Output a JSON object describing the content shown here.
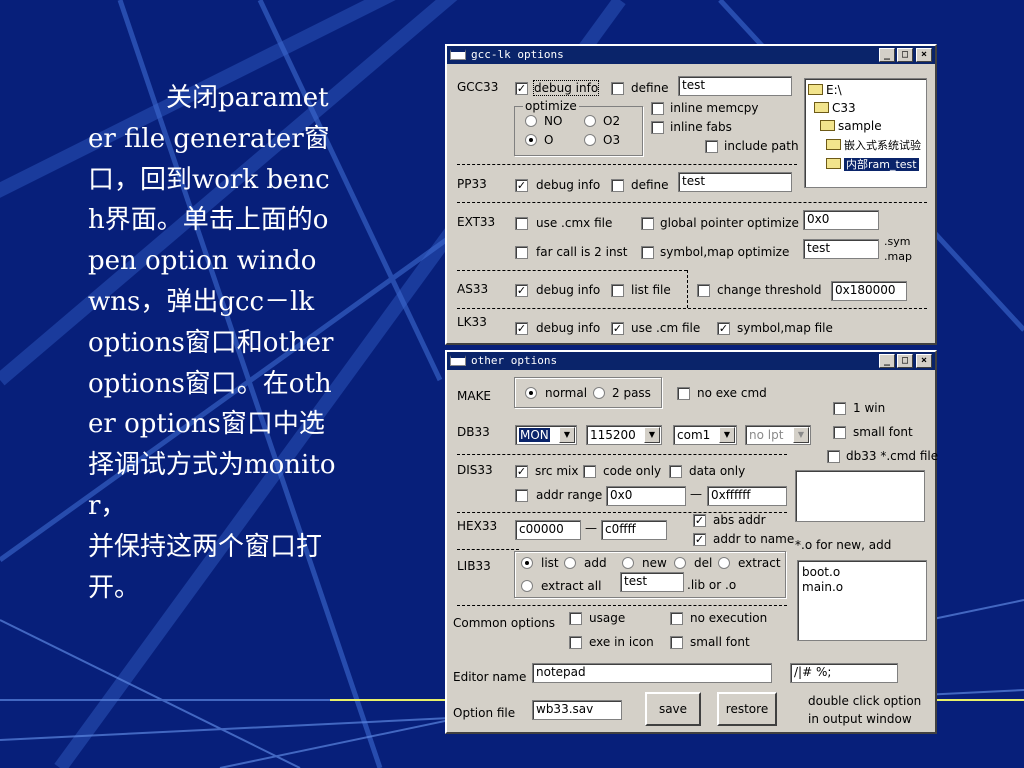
{
  "slide_text": "关闭parameter file generater窗口，回到work bench界面。单击上面的open option windowns，弹出gcc－lk options窗口和other options窗口。在other options窗口中选择调试方式为monitor，\n并保持这两个窗口打开。",
  "colors": {
    "slide_bg": "#071f7a",
    "titlebar": "#0a246a",
    "window_face": "#d4d0c8"
  },
  "gcc_window": {
    "title": "gcc-lk options",
    "controls": [
      "_",
      "□",
      "×"
    ],
    "gcc33": {
      "label": "GCC33",
      "debug_info": {
        "label": "debug info",
        "checked": true
      },
      "define": {
        "label": "define",
        "checked": false,
        "value": "test"
      },
      "optimize": {
        "title": "optimize",
        "options": [
          {
            "label": "NO",
            "selected": false
          },
          {
            "label": "O2",
            "selected": false
          },
          {
            "label": "O",
            "selected": true
          },
          {
            "label": "O3",
            "selected": false
          }
        ]
      },
      "inline_memcpy": {
        "label": "inline memcpy",
        "checked": false
      },
      "inline_fabs": {
        "label": "inline fabs",
        "checked": false
      },
      "include_path": {
        "label": "include path",
        "checked": false
      }
    },
    "tree": {
      "nodes": [
        {
          "label": "E:\\"
        },
        {
          "label": "C33"
        },
        {
          "label": "sample"
        },
        {
          "label": "嵌入式系统试验"
        },
        {
          "label": "内部ram_test",
          "selected": true
        }
      ]
    },
    "pp33": {
      "label": "PP33",
      "debug_info": {
        "label": "debug info",
        "checked": true
      },
      "define": {
        "label": "define",
        "checked": false,
        "value": "test"
      }
    },
    "ext33": {
      "label": "EXT33",
      "use_cmx": {
        "label": "use .cmx file",
        "checked": false
      },
      "global_pointer": {
        "label": "global pointer optimize",
        "checked": false,
        "value": "0x0"
      },
      "far_call": {
        "label": "far call is 2 inst",
        "checked": false
      },
      "symbol_map": {
        "label": "symbol,map optimize",
        "checked": false,
        "value": "test"
      },
      "sym_ext": ".sym",
      "map_ext": ".map"
    },
    "as33": {
      "label": "AS33",
      "debug_info": {
        "label": "debug info",
        "checked": true
      },
      "list_file": {
        "label": "list file",
        "checked": false
      },
      "change_threshold": {
        "label": "change threshold",
        "checked": false,
        "value": "0x180000"
      }
    },
    "lk33": {
      "label": "LK33",
      "debug_info": {
        "label": "debug info",
        "checked": true
      },
      "use_cm": {
        "label": "use .cm file",
        "checked": true
      },
      "symbol_map_file": {
        "label": "symbol,map file",
        "checked": true
      }
    }
  },
  "other_window": {
    "title": "other options",
    "controls": [
      "_",
      "□",
      "×"
    ],
    "make": {
      "label": "MAKE",
      "normal": {
        "label": "normal",
        "selected": true
      },
      "two_pass": {
        "label": "2 pass",
        "selected": false
      },
      "no_exe_cmd": {
        "label": "no exe cmd",
        "checked": false
      }
    },
    "one_win": {
      "label": "1 win",
      "checked": false
    },
    "small_font_top": {
      "label": "small font",
      "checked": false
    },
    "db33_cmd": {
      "label": "db33 *.cmd file",
      "checked": false
    },
    "db33": {
      "label": "DB33",
      "mode": "MON",
      "baud": "115200",
      "port": "com1",
      "lpt": "no lpt"
    },
    "dis33": {
      "label": "DIS33",
      "src_mix": {
        "label": "src mix",
        "checked": true
      },
      "code_only": {
        "label": "code only",
        "checked": false
      },
      "data_only": {
        "label": "data only",
        "checked": false
      },
      "addr_range": {
        "label": "addr range",
        "checked": false,
        "from": "0x0",
        "dash": "—",
        "to": "0xffffff"
      }
    },
    "hex33": {
      "label": "HEX33",
      "from": "c00000",
      "dash": "—",
      "to": "c0ffff",
      "abs_addr": {
        "label": "abs addr",
        "checked": true
      },
      "addr_to_name": {
        "label": "addr to name",
        "checked": true
      }
    },
    "o_hint": "*.o for new, add",
    "lib33": {
      "label": "LIB33",
      "ops": [
        {
          "label": "list",
          "selected": true
        },
        {
          "label": "add",
          "selected": false
        },
        {
          "label": "new",
          "selected": false
        },
        {
          "label": "del",
          "selected": false
        },
        {
          "label": "extract",
          "selected": false
        },
        {
          "label": "extract all",
          "selected": false
        }
      ],
      "lib_name": "test",
      "lib_hint": ".lib or .o"
    },
    "obj_files": [
      "boot.o",
      "main.o"
    ],
    "common": {
      "label": "Common options",
      "usage": {
        "label": "usage",
        "checked": false
      },
      "no_execution": {
        "label": "no execution",
        "checked": false
      },
      "exe_in_icon": {
        "label": "exe in icon",
        "checked": false
      },
      "small_font": {
        "label": "small font",
        "checked": false
      }
    },
    "editor": {
      "label": "Editor name",
      "value": "notepad",
      "comment": "/|# %;"
    },
    "option_file": {
      "label": "Option file",
      "value": "wb33.sav",
      "save": "save",
      "restore": "restore"
    },
    "hint": "double click option\nin output window"
  }
}
